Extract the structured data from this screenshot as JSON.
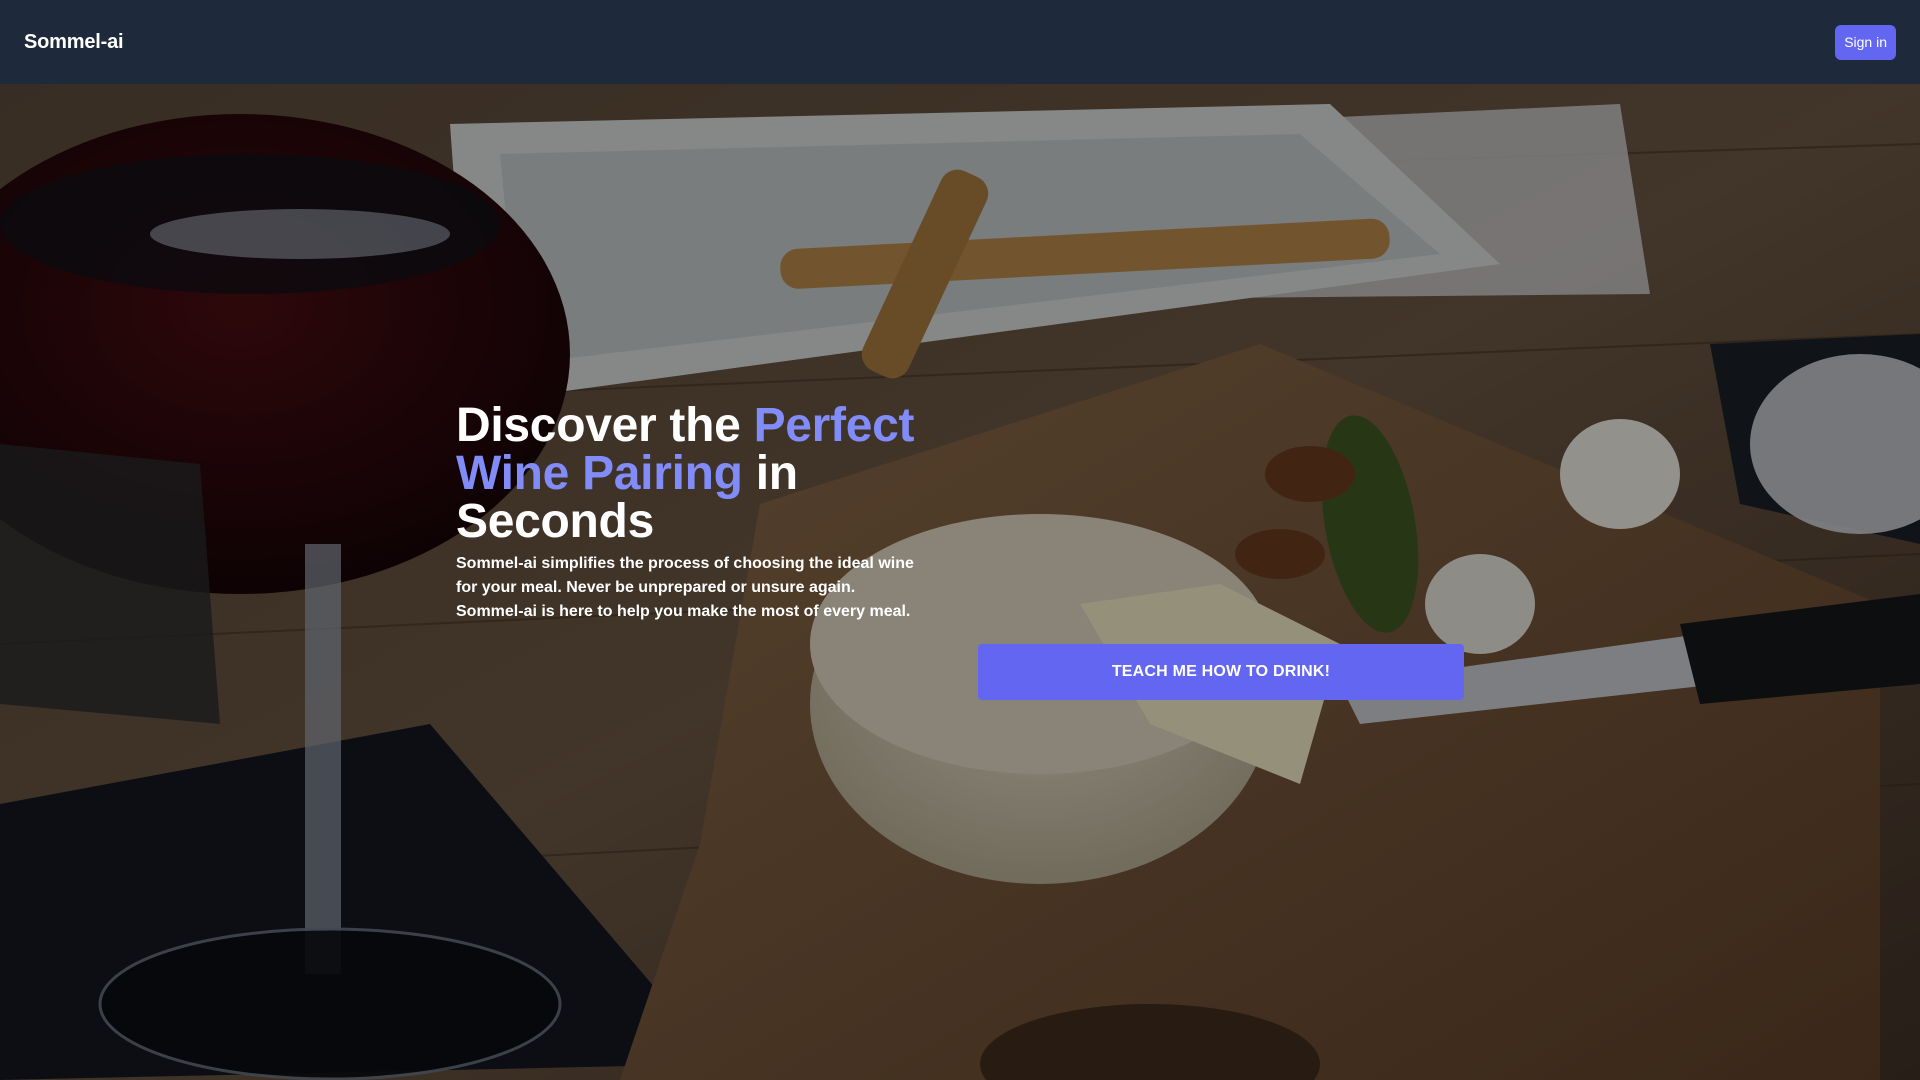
{
  "navbar": {
    "brand": "Sommel-ai",
    "signin_label": "Sign in"
  },
  "hero": {
    "headline_part1": "Discover the ",
    "headline_accent": "Perfect Wine Pairing",
    "headline_part2": " in Seconds",
    "description": "Sommel-ai simplifies the process of choosing the ideal wine for your meal. Never be unprepared or unsure again. Sommel-ai is here to help you make the most of every meal.",
    "cta_label": "TEACH ME HOW TO DRINK!",
    "background_image": "wine-and-cheese-table-photo"
  },
  "colors": {
    "navbar_bg": "#1e293b",
    "accent": "#6366f1",
    "headline_accent": "#818cf8",
    "text": "#ffffff"
  }
}
